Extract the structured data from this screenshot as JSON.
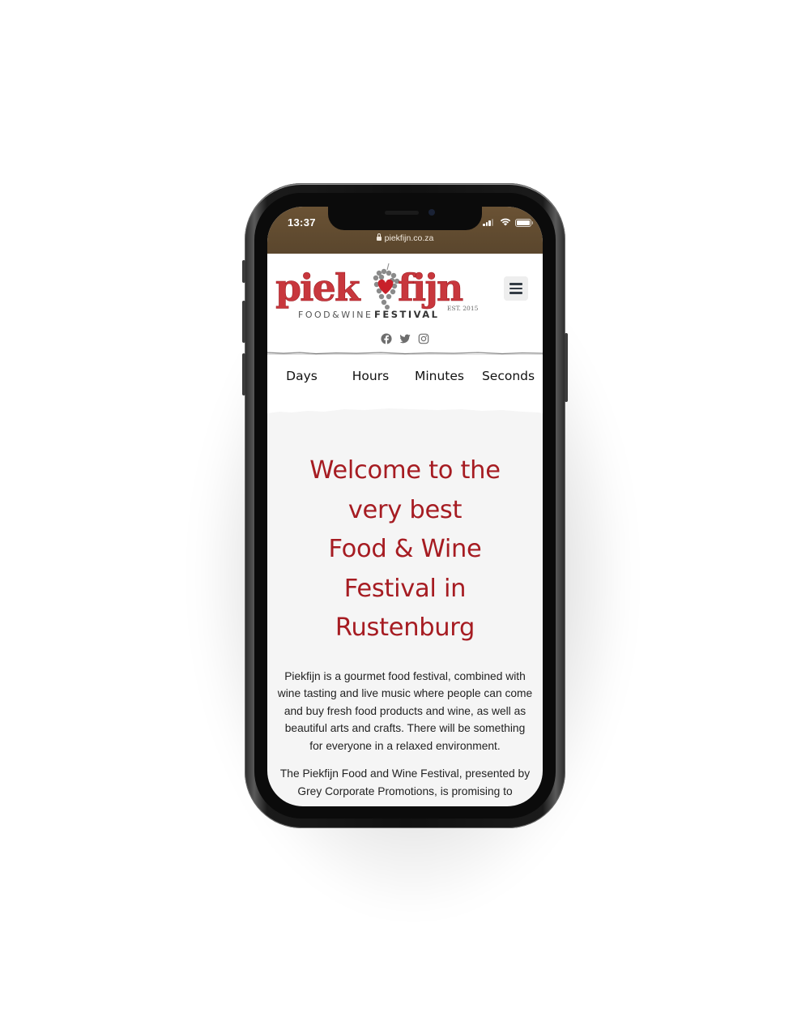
{
  "status_bar": {
    "time": "13:37",
    "url": "piekfijn.co.za",
    "icons": [
      "lock-icon",
      "signal-icon",
      "wifi-icon",
      "battery-icon"
    ]
  },
  "header": {
    "logo": {
      "word_left": "piek",
      "word_right": "fijn",
      "tagline_light": "FOOD&WINE",
      "tagline_bold": "FESTIVAL",
      "established": "EST. 2015"
    },
    "menu_icon": "hamburger-menu-icon",
    "social": [
      {
        "name": "facebook-icon"
      },
      {
        "name": "twitter-icon"
      },
      {
        "name": "instagram-icon"
      }
    ]
  },
  "countdown": {
    "labels": [
      "Days",
      "Hours",
      "Minutes",
      "Seconds"
    ]
  },
  "content": {
    "title_lines": [
      "Welcome to the",
      "very best",
      "Food & Wine",
      "Festival in",
      "Rustenburg"
    ],
    "paragraph1": "Piekfijn is a gourmet food festival, combined with wine tasting and live music where people can come and buy fresh food products and wine, as well as beautiful arts and crafts. There will be something for everyone in a relaxed environment.",
    "paragraph2": "The Piekfijn Food and Wine Festival, presented by Grey Corporate Promotions, is promising to"
  },
  "colors": {
    "brand_red": "#a61c22",
    "status_bar_brown": "#5f4a30",
    "menu_button_bg": "#eeeeee",
    "content_bg": "#f5f5f5"
  }
}
